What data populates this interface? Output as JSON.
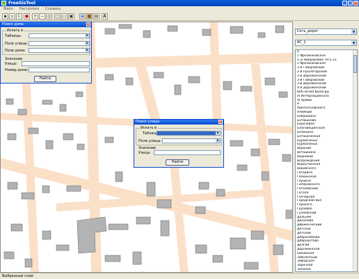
{
  "app": {
    "title": "FreeGisTool"
  },
  "menu": [
    "Файл",
    "Настройки",
    "Справка"
  ],
  "toolbar": [
    "save-icon",
    "open-icon",
    "print-icon",
    "zoom-in-icon",
    "zoom-out-icon",
    "zoom-extent-icon",
    "pan-icon",
    "select-icon",
    "layers-icon",
    "info-icon",
    "text-icon"
  ],
  "right_panel": {
    "layer_combo": "Сеть_дорог",
    "layer_combo2": "AC_1",
    "streets": [
      "0",
      "1 Фрезинковская",
      "1_й микрорайон ППЗ 23",
      "2 Фрезинковская",
      "2-й Говоровский",
      "2-й Пролетарский",
      "3-й Дорожинский",
      "3-й Говоровский",
      "3-й Дорожинский",
      "4-й Дорожинский",
      "800-летия Вологды",
      "III Интернационала",
      "VI Армии",
      "А",
      "Авксентьевского",
      "Алейный",
      "Бабушкина",
      "Батюшкова",
      "Березовая",
      "Благовещенская",
      "Болонина",
      "Ботаническая",
      "Бурмагиных",
      "Бурмагиных",
      "Верхний",
      "Ветошкина",
      "Водников",
      "Возрождения",
      "Воркутинская",
      "Воровского",
      "Гагарина",
      "Галкинская",
      "Герцена",
      "Гиляровского",
      "Гоголевский",
      "Гоголя",
      "Гончарная",
      "Городской Вал",
      "Горького",
      "Грузовая",
      "Гуляевский",
      "Дальняя",
      "Данилова",
      "Движенческий",
      "Детская",
      "Детский",
      "Добролюбова",
      "Доброхотова",
      "Долгий",
      "Дорожинская",
      "Евковская",
      "Заболотный",
      "Заводская",
      "Заречная",
      "Зеленая",
      "Зелинского",
      "Зосимовская"
    ]
  },
  "dialog1": {
    "title": "Поиск дома",
    "group_label": "Искать в",
    "table_label": "Таблица:",
    "street_field_label": "Поле улицы:",
    "house_field_label": "Поле дома:",
    "value_label": "Значение",
    "street_label": "Улица:",
    "house_no_label": "Номер дома:",
    "find_button": "Найти"
  },
  "dialog2": {
    "title": "Поиск улицы",
    "group_label": "Искать в",
    "table_label": "Таблица:",
    "street_field_label": "Поле улицы:",
    "value_label": "Значение",
    "street_label": "Улица:",
    "find_button": "Найти"
  },
  "status": {
    "selected_layer": "Выбранный слой:"
  },
  "colors": {
    "road": "#fbe0c8",
    "building": "#b3b3b3",
    "titlebar": "#0a53d0",
    "selection": "#316ac5"
  }
}
